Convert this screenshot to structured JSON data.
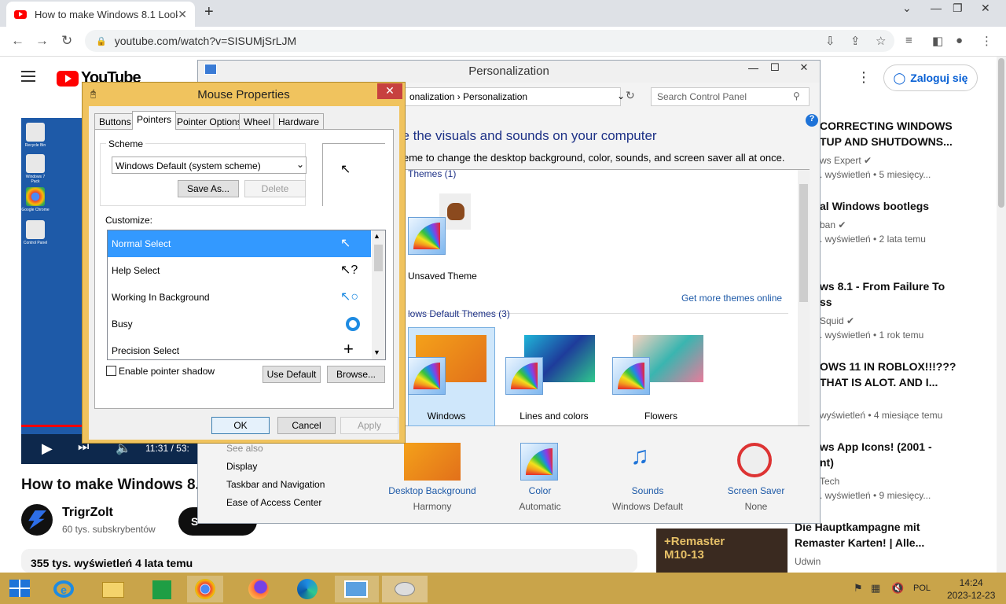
{
  "browser": {
    "tab_title": "How to make Windows 8.1 Look",
    "url": "youtube.com/watch?v=SISUMjSrLJM",
    "new_tab": "+",
    "close_tab": "✕"
  },
  "youtube": {
    "logo_text": "YouTube",
    "signin_label": "Zaloguj się",
    "video_title": "How to make Windows 8.1 Look",
    "video_time": "11:31 / 53:",
    "channel_name": "TrigrZolt",
    "channel_subs": "60 tys. subskrybentów",
    "subscribe_label": "S",
    "views_line": "355 tys. wyświetleń  4 lata temu",
    "desktop_icons": [
      "Recycle Bin",
      "Windows 7 Pack",
      "Google Chrome",
      "Control Panel"
    ],
    "recommendations": [
      {
        "title_line1": "CORRECTING WINDOWS",
        "title_line2": "TUP AND SHUTDOWNS...",
        "meta1": "ws Expert ✔",
        "meta2": ". wyświetleń  • 5 miesięcy..."
      },
      {
        "title_line1": "al Windows bootlegs",
        "title_line2": "",
        "meta1": "ban ✔",
        "meta2": ". wyświetleń  • 2 lata temu"
      },
      {
        "title_line1": "ws 8.1 - From Failure To",
        "title_line2": "ss",
        "meta1": "Squid ✔",
        "meta2": ". wyświetleń  • 1 rok temu"
      },
      {
        "title_line1": "OWS 11 IN ROBLOX!!!???",
        "title_line2": " THAT IS ALOT. AND I...",
        "meta1": "",
        "meta2": "wyświetleń  • 4 miesiące temu"
      },
      {
        "title_line1": "ws App Icons! (2001 -",
        "title_line2": "nt)",
        "meta1": "Tech",
        "meta2": ". wyświetleń  • 9 miesięcy..."
      },
      {
        "title_line1": "Die Hauptkampagne mit",
        "title_line2": "Remaster Karten! | Alle...",
        "meta1": "Udwin",
        "meta2": ""
      }
    ],
    "thumb_text_line1": "+Remaster",
    "thumb_text_line2": "M10-13"
  },
  "personalization": {
    "title": "Personalization",
    "address_part1": "onalization",
    "address_part2": "Personalization",
    "search_placeholder": "Search Control Panel",
    "heading": "ge the visuals and sounds on your computer",
    "subheading": "theme to change the desktop background, color, sounds, and screen saver all at once.",
    "my_themes_label": "Themes (1)",
    "unsaved_theme": "Unsaved Theme",
    "get_more": "Get more themes online",
    "default_themes_label": "lows Default Themes (3)",
    "themes": [
      "Windows",
      "Lines and colors",
      "Flowers"
    ],
    "see_also": "See also",
    "see_also_links": [
      "Display",
      "Taskbar and Navigation",
      "Ease of Access Center"
    ],
    "bottom": [
      {
        "name": "Desktop Background",
        "value": "Harmony"
      },
      {
        "name": "Color",
        "value": "Automatic"
      },
      {
        "name": "Sounds",
        "value": "Windows Default"
      },
      {
        "name": "Screen Saver",
        "value": "None"
      }
    ]
  },
  "mouse": {
    "title": "Mouse Properties",
    "tabs": [
      "Buttons",
      "Pointers",
      "Pointer Options",
      "Wheel",
      "Hardware"
    ],
    "scheme_label": "Scheme",
    "scheme_value": "Windows Default (system scheme)",
    "save_as": "Save As...",
    "delete": "Delete",
    "customize_label": "Customize:",
    "items": [
      "Normal Select",
      "Help Select",
      "Working In Background",
      "Busy",
      "Precision Select"
    ],
    "shadow_label": "Enable pointer shadow",
    "use_default": "Use Default",
    "browse": "Browse...",
    "ok": "OK",
    "cancel": "Cancel",
    "apply": "Apply"
  },
  "taskbar": {
    "lang": "POL",
    "time": "14:24",
    "date": "2023-12-23"
  }
}
